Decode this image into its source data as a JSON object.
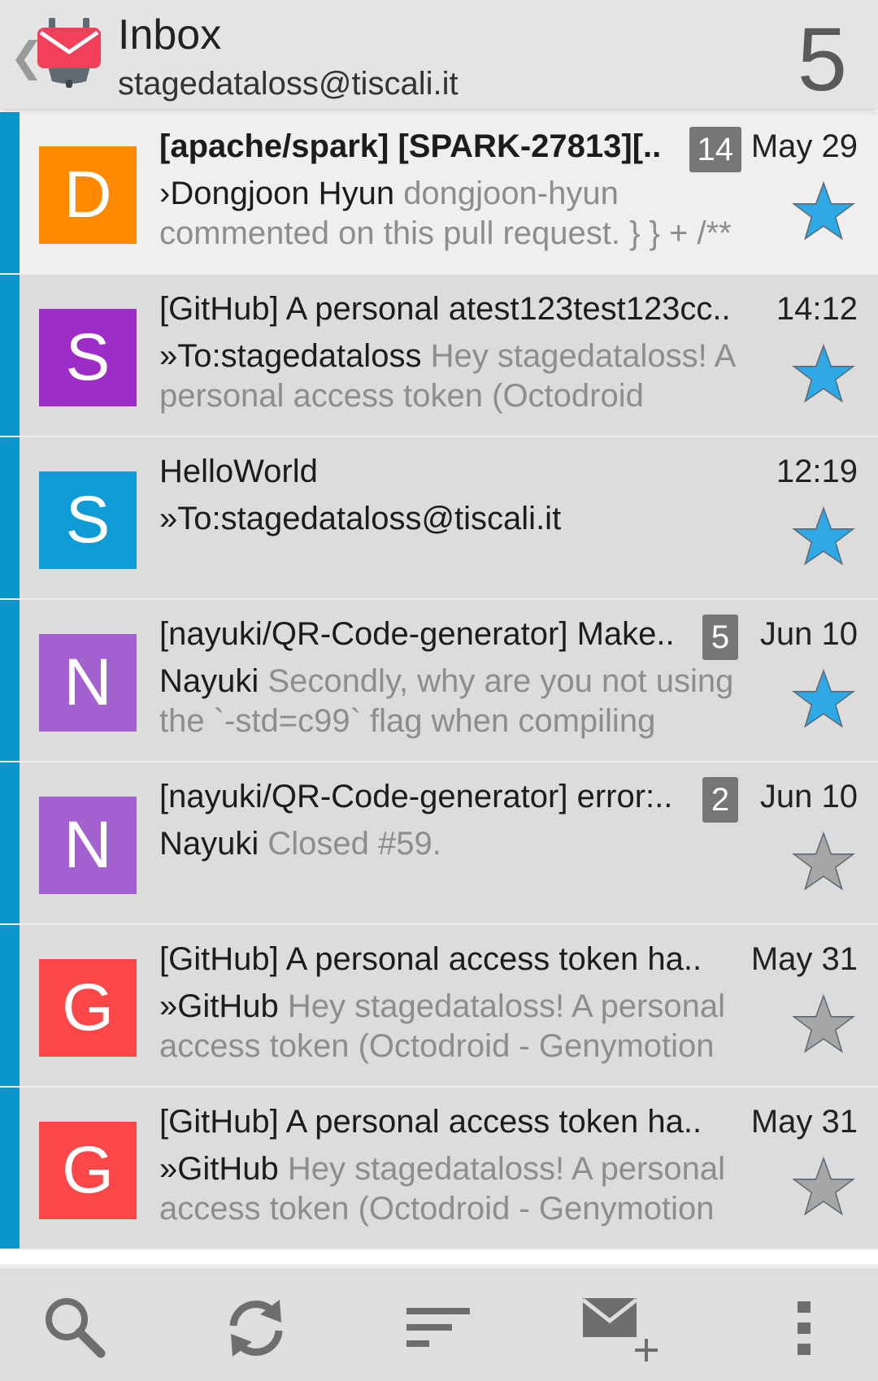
{
  "header": {
    "title": "Inbox",
    "account": "stagedataloss@tiscali.it",
    "unread_count": "5"
  },
  "colors": {
    "accent_stripe": "#0797cc",
    "star_active": "#2fa8e6",
    "star_inactive": "#a6a6a6"
  },
  "messages": [
    {
      "avatar_letter": "D",
      "avatar_color": "#ff8a00",
      "subject": "[apache/spark] [SPARK-27813][..",
      "sender": "›Dongjoon Hyun",
      "preview": "dongjoon-hyun commented on this pull request. } } + /**",
      "count": "14",
      "date": "May 29",
      "starred": true,
      "unread": true
    },
    {
      "avatar_letter": "S",
      "avatar_color": "#9c2dc6",
      "subject": "[GitHub] A personal atest123test123cc..",
      "sender": "»To:stagedataloss",
      "preview": "Hey stagedataloss! A personal access token (Octodroid",
      "count": "",
      "date": "14:12",
      "starred": true,
      "unread": false
    },
    {
      "avatar_letter": "S",
      "avatar_color": "#0f9bd6",
      "subject": "HelloWorld",
      "sender": "»To:stagedataloss@tiscali.it",
      "preview": "",
      "count": "",
      "date": "12:19",
      "starred": true,
      "unread": false
    },
    {
      "avatar_letter": "N",
      "avatar_color": "#a360cf",
      "subject": "[nayuki/QR-Code-generator] Make..",
      "sender": "Nayuki",
      "preview": "Secondly, why are you not using the `-std=c99` flag when compiling",
      "count": "5",
      "date": "Jun 10",
      "starred": true,
      "unread": false
    },
    {
      "avatar_letter": "N",
      "avatar_color": "#a360cf",
      "subject": "[nayuki/QR-Code-generator] error:..",
      "sender": "Nayuki",
      "preview": "Closed #59.",
      "count": "2",
      "date": "Jun 10",
      "starred": false,
      "unread": false
    },
    {
      "avatar_letter": "G",
      "avatar_color": "#fb4747",
      "subject": "[GitHub] A personal access token ha..",
      "sender": "»GitHub",
      "preview": "Hey stagedataloss! A personal access token (Octodroid - Genymotion",
      "count": "",
      "date": "May 31",
      "starred": false,
      "unread": false
    },
    {
      "avatar_letter": "G",
      "avatar_color": "#fb4747",
      "subject": "[GitHub] A personal access token ha..",
      "sender": "»GitHub",
      "preview": "Hey stagedataloss! A personal access token (Octodroid - Genymotion",
      "count": "",
      "date": "May 31",
      "starred": false,
      "unread": false
    }
  ],
  "bottom_bar": {
    "buttons": [
      "search-icon",
      "refresh-icon",
      "sort-icon",
      "compose-icon",
      "overflow-menu-icon"
    ]
  }
}
